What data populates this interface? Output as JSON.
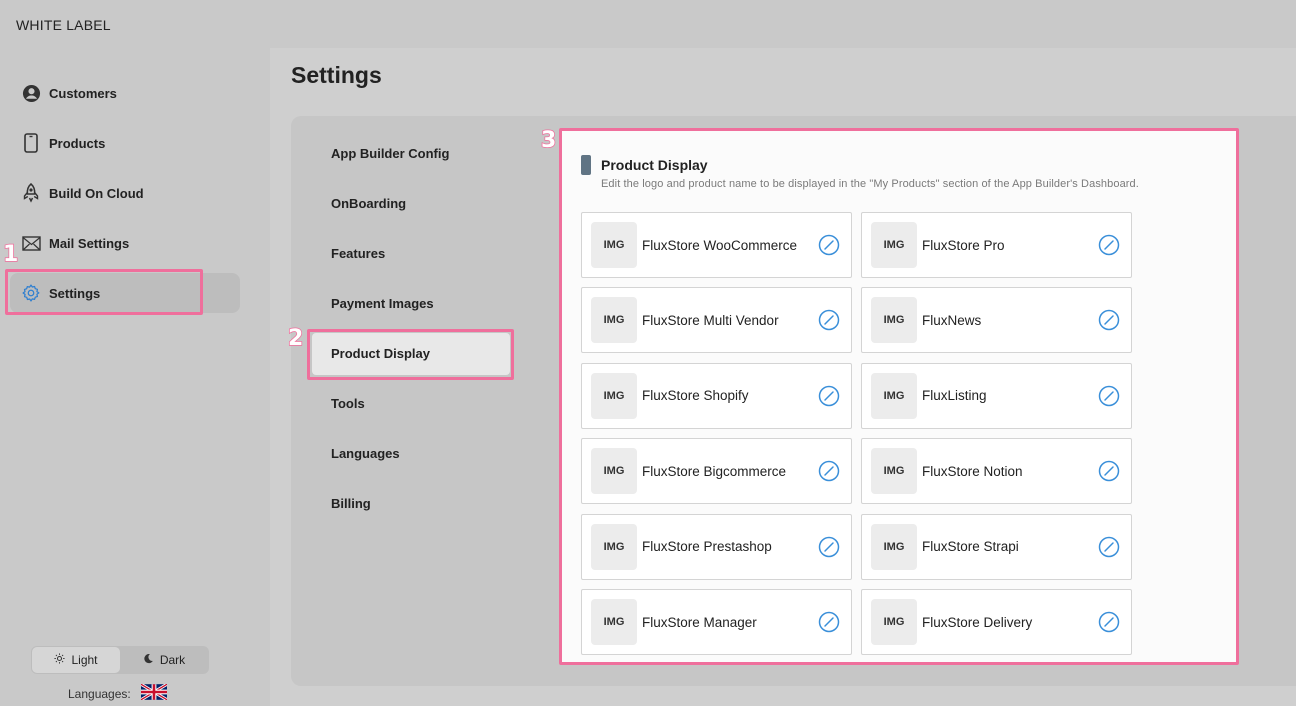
{
  "brand": "WHITE LABEL",
  "sidebar": {
    "items": [
      {
        "label": "Customers",
        "icon": "user-circle-icon"
      },
      {
        "label": "Products",
        "icon": "phone-icon"
      },
      {
        "label": "Build On Cloud",
        "icon": "rocket-icon"
      },
      {
        "label": "Mail Settings",
        "icon": "mail-icon"
      },
      {
        "label": "Settings",
        "icon": "gear-icon"
      }
    ],
    "active_index": 4
  },
  "theme": {
    "light_label": "Light",
    "dark_label": "Dark",
    "selected": "Light"
  },
  "languages": {
    "label": "Languages:",
    "flag": "uk-flag-icon"
  },
  "page_title": "Settings",
  "settings_menu": {
    "items": [
      "App Builder Config",
      "OnBoarding",
      "Features",
      "Payment Images",
      "Product Display",
      "Tools",
      "Languages",
      "Billing"
    ],
    "active": "Product Display"
  },
  "section": {
    "title": "Product Display",
    "description": "Edit the logo and product name to be displayed in the \"My Products\" section of the App Builder's Dashboard."
  },
  "products": [
    {
      "thumb": "IMG",
      "name": "FluxStore WooCommerce"
    },
    {
      "thumb": "IMG",
      "name": "FluxStore Pro"
    },
    {
      "thumb": "IMG",
      "name": "FluxStore Multi Vendor"
    },
    {
      "thumb": "IMG",
      "name": "FluxNews"
    },
    {
      "thumb": "IMG",
      "name": "FluxStore Shopify"
    },
    {
      "thumb": "IMG",
      "name": "FluxListing"
    },
    {
      "thumb": "IMG",
      "name": "FluxStore Bigcommerce"
    },
    {
      "thumb": "IMG",
      "name": "FluxStore Notion"
    },
    {
      "thumb": "IMG",
      "name": "FluxStore Prestashop"
    },
    {
      "thumb": "IMG",
      "name": "FluxStore Strapi"
    },
    {
      "thumb": "IMG",
      "name": "FluxStore Manager"
    },
    {
      "thumb": "IMG",
      "name": "FluxStore Delivery"
    }
  ],
  "annotations": [
    "1",
    "2",
    "3"
  ],
  "colors": {
    "highlight": "#ef6f9c",
    "edit_icon": "#3a8fd9",
    "section_bar": "#607484"
  }
}
